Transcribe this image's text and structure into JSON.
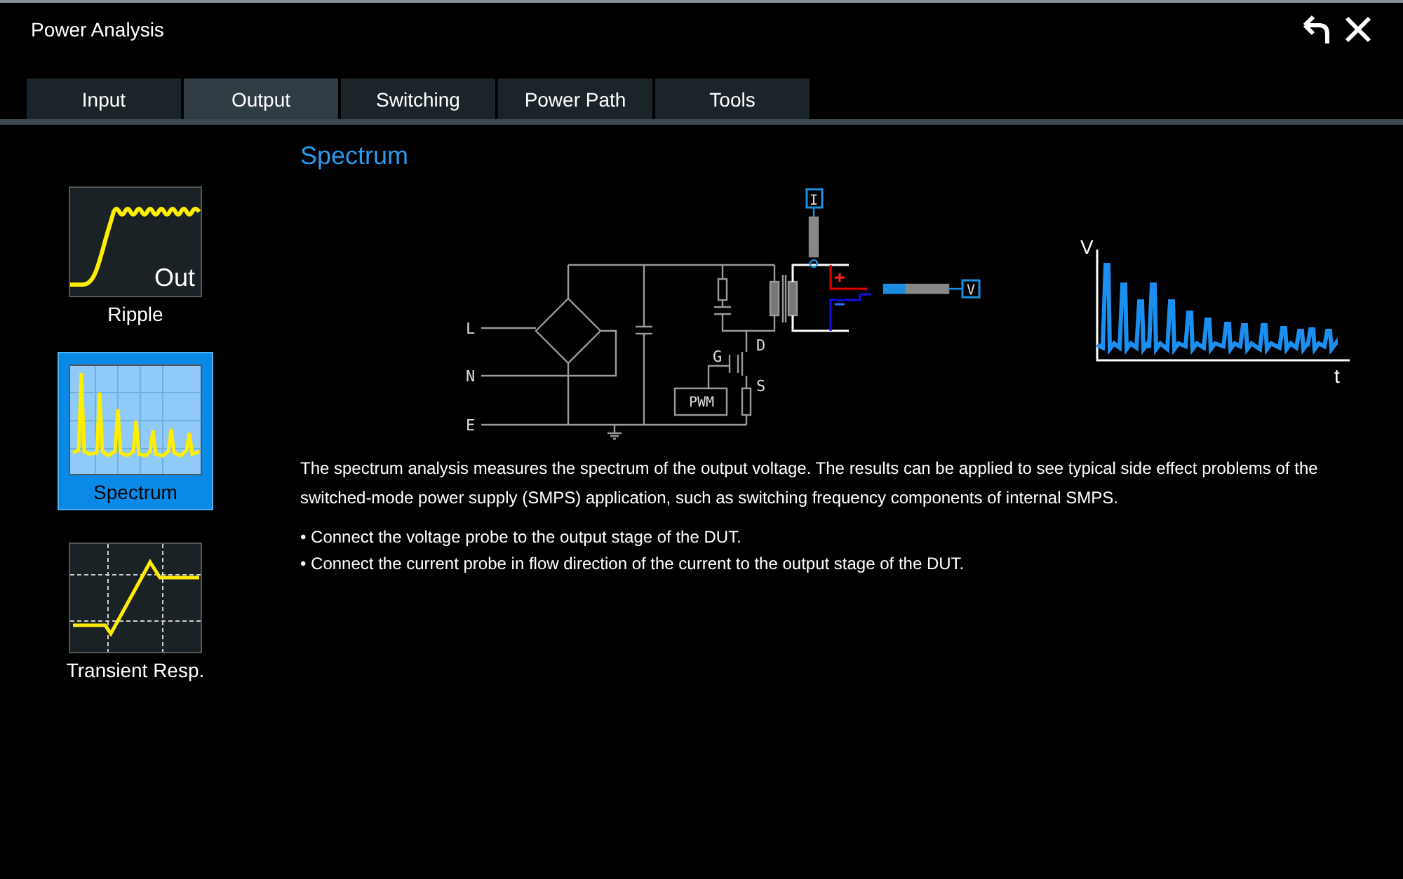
{
  "window": {
    "title": "Power Analysis"
  },
  "tabs": [
    {
      "label": "Input",
      "selected": false
    },
    {
      "label": "Output",
      "selected": true
    },
    {
      "label": "Switching",
      "selected": false
    },
    {
      "label": "Power Path",
      "selected": false
    },
    {
      "label": "Tools",
      "selected": false
    }
  ],
  "sidebar": {
    "items": [
      {
        "kind": "ripple",
        "label": "Ripple",
        "overlay_text": "Out",
        "selected": false
      },
      {
        "kind": "spectrum",
        "label": "Spectrum",
        "selected": true
      },
      {
        "kind": "transient",
        "label": "Transient Resp.",
        "selected": false
      }
    ]
  },
  "content": {
    "heading": "Spectrum",
    "circuit": {
      "labels": [
        "L",
        "N",
        "E",
        "G",
        "D",
        "S",
        "PWM",
        "I",
        "V"
      ]
    },
    "waveform": {
      "y_label": "V",
      "x_label": "t"
    },
    "description": "The spectrum analysis measures the spectrum of the output voltage. The results can be applied to see typical side effect problems of the switched-mode power supply (SMPS) application, such as switching frequency components of internal SMPS.",
    "bullets": [
      "• Connect the voltage probe to the output stage of the DUT.",
      "• Connect the current probe in flow direction of the current to the output stage of the DUT."
    ]
  }
}
